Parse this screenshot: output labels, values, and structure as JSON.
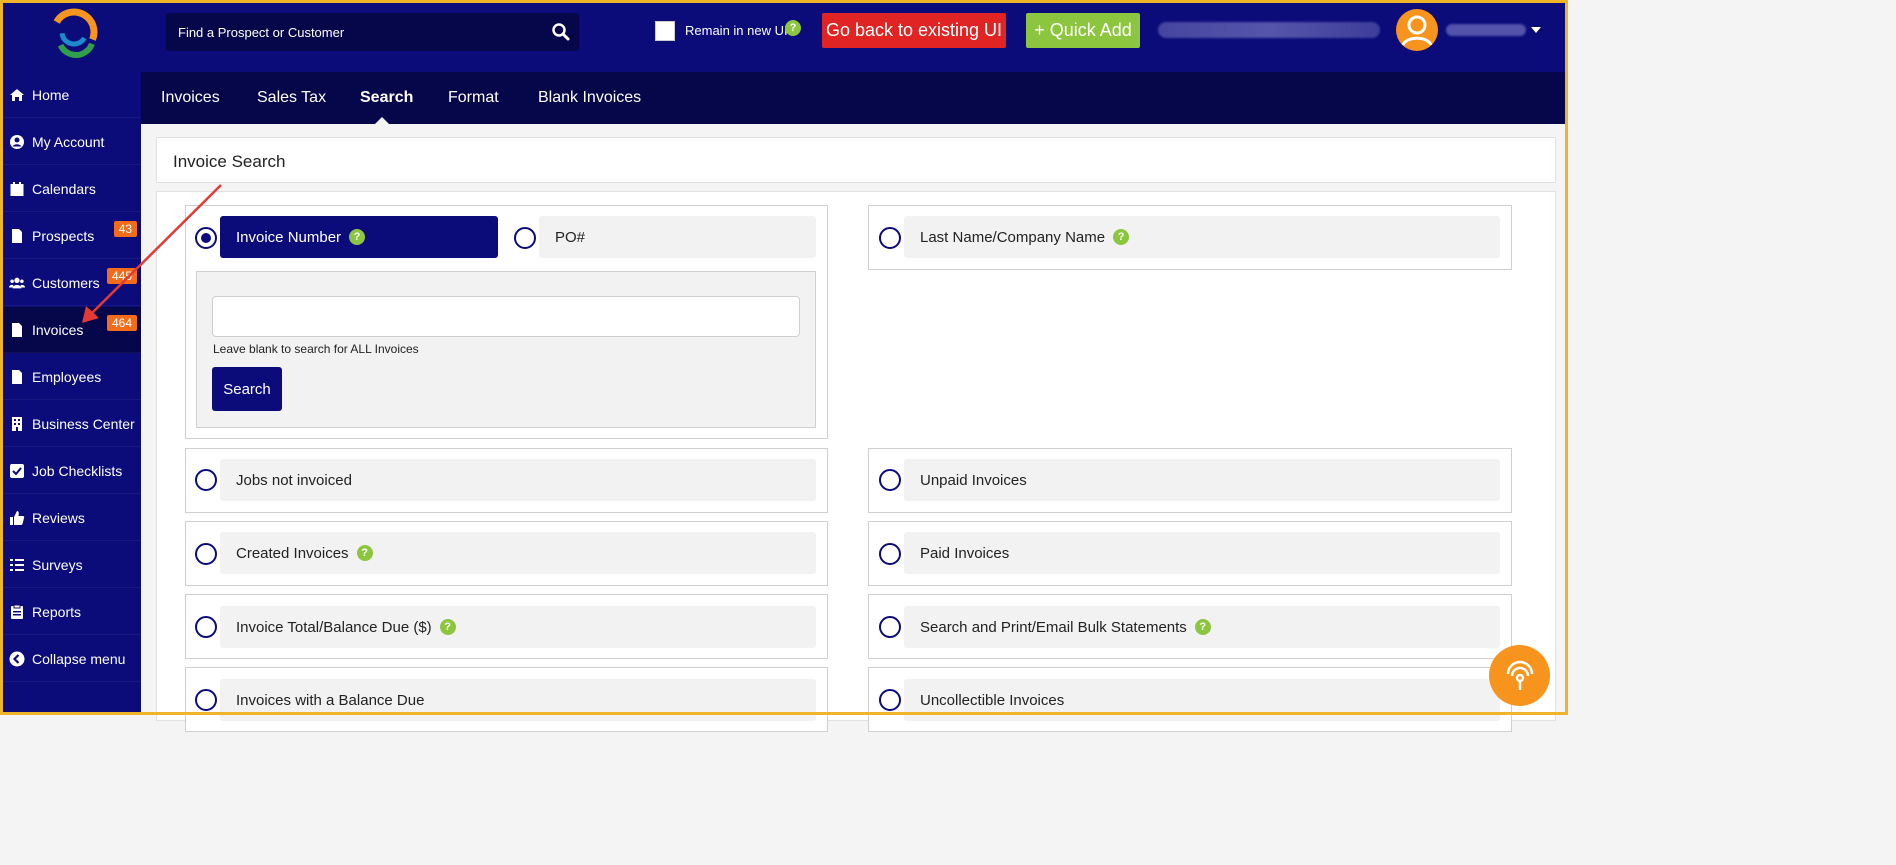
{
  "topbar": {
    "search_placeholder": "Find a Prospect or Customer",
    "remain_label": "Remain in new UI",
    "help_glyph": "?",
    "goback_label": "Go back to existing UI",
    "quickadd_label": "+ Quick Add"
  },
  "sidebar": {
    "items": [
      {
        "label": "Home",
        "icon": "home-icon"
      },
      {
        "label": "My Account",
        "icon": "user-circle-icon"
      },
      {
        "label": "Calendars",
        "icon": "calendar-icon"
      },
      {
        "label": "Prospects",
        "icon": "file-icon",
        "badge": "43"
      },
      {
        "label": "Customers",
        "icon": "users-icon",
        "badge": "445"
      },
      {
        "label": "Invoices",
        "icon": "file-icon",
        "badge": "464"
      },
      {
        "label": "Employees",
        "icon": "file-icon"
      },
      {
        "label": "Business Center",
        "icon": "building-icon"
      },
      {
        "label": "Job Checklists",
        "icon": "checkbox-icon"
      },
      {
        "label": "Reviews",
        "icon": "thumbs-up-icon"
      },
      {
        "label": "Surveys",
        "icon": "list-icon"
      },
      {
        "label": "Reports",
        "icon": "clipboard-icon"
      },
      {
        "label": "Collapse menu",
        "icon": "chevron-left-circle-icon"
      }
    ]
  },
  "tabs": [
    "Invoices",
    "Sales Tax",
    "Search",
    "Format",
    "Blank Invoices"
  ],
  "active_tab": "Search",
  "page_title": "Invoice Search",
  "search": {
    "invoice_number_label": "Invoice Number",
    "po_label": "PO#",
    "last_name_label": "Last Name/Company Name",
    "input_value": "",
    "hint": "Leave blank to search for ALL Invoices",
    "search_button": "Search"
  },
  "options": {
    "jobs_not_invoiced": "Jobs not invoiced",
    "unpaid_invoices": "Unpaid Invoices",
    "created_invoices": "Created Invoices",
    "paid_invoices": "Paid Invoices",
    "invoice_total": "Invoice Total/Balance Due ($)",
    "bulk_statements": "Search and Print/Email Bulk Statements",
    "balance_due": "Invoices with a Balance Due",
    "uncollectible": "Uncollectible Invoices"
  },
  "colors": {
    "navy": "#0b0b7a",
    "dark_navy": "#06064a",
    "red": "#e02424",
    "green": "#8cc63f",
    "orange": "#f7941d",
    "badge_orange": "#f26c1a",
    "frame_yellow": "#f0b429",
    "annotation_red": "#e53935"
  }
}
